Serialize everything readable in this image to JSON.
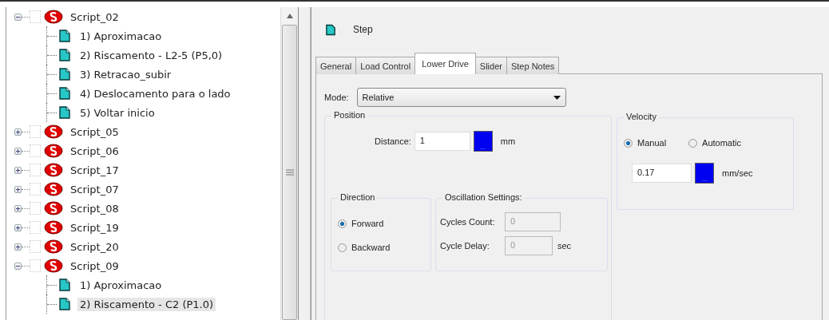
{
  "tree": [
    {
      "label": "Script_02",
      "expanded": true,
      "checked": false,
      "selected": false,
      "children": [
        {
          "label": "1)  Aproximacao",
          "selected": false
        },
        {
          "label": "2)  Riscamento - L2-5 (P5,0)",
          "selected": false
        },
        {
          "label": "3)  Retracao_subir",
          "selected": false
        },
        {
          "label": "4)  Deslocamento para o lado",
          "selected": false
        },
        {
          "label": "5)  Voltar inicio",
          "selected": false
        }
      ]
    },
    {
      "label": "Script_05",
      "expanded": false,
      "checked": false,
      "selected": false
    },
    {
      "label": "Script_06",
      "expanded": false,
      "checked": false,
      "selected": false
    },
    {
      "label": "Script_17",
      "expanded": false,
      "checked": false,
      "selected": false
    },
    {
      "label": "Script_07",
      "expanded": false,
      "checked": false,
      "selected": false
    },
    {
      "label": "Script_08",
      "expanded": false,
      "checked": false,
      "selected": false
    },
    {
      "label": "Script_19",
      "expanded": false,
      "checked": false,
      "selected": false
    },
    {
      "label": "Script_20",
      "expanded": false,
      "checked": false,
      "selected": false
    },
    {
      "label": "Script_09",
      "expanded": true,
      "checked": false,
      "selected": false,
      "children": [
        {
          "label": "1)  Aproximacao",
          "selected": false
        },
        {
          "label": "2)  Riscamento - C2 (P1.0)",
          "selected": true
        }
      ]
    }
  ],
  "step": {
    "title": "Step"
  },
  "tabs": [
    {
      "label": "General",
      "selected": false
    },
    {
      "label": "Load Control",
      "selected": false
    },
    {
      "label": "Lower Drive",
      "selected": true
    },
    {
      "label": "Slider",
      "selected": false
    },
    {
      "label": "Step Notes",
      "selected": false
    }
  ],
  "mode": {
    "label": "Mode:",
    "value": "Relative"
  },
  "position": {
    "title": "Position",
    "distance_label": "Distance:",
    "distance": "1",
    "browse": "...",
    "unit": "mm"
  },
  "direction": {
    "title": "Direction",
    "options": [
      {
        "label": "Forward",
        "selected": true
      },
      {
        "label": "Backward",
        "selected": false
      }
    ]
  },
  "oscillation": {
    "title": "Oscillation Settings:",
    "cycles_label": "Cycles Count:",
    "cycles": "0",
    "delay_label": "Cycle Delay:",
    "delay": "0",
    "delay_unit": "sec"
  },
  "velocity": {
    "title": "Velocity",
    "options": [
      {
        "label": "Manual",
        "selected": true
      },
      {
        "label": "Automatic",
        "selected": false
      }
    ],
    "value": "0.17",
    "browse": "...",
    "unit": "mm/sec"
  }
}
